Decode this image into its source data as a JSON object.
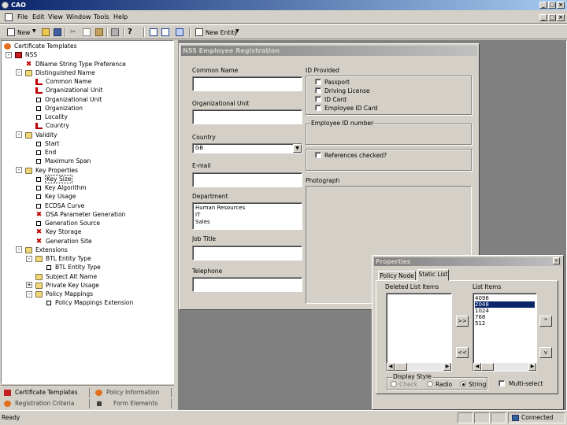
{
  "app": {
    "title": "CAO"
  },
  "menu": [
    "File",
    "Edit",
    "View",
    "Window",
    "Tools",
    "Help"
  ],
  "toolbar": {
    "new_label": "New",
    "new_entity_label": "New Entity"
  },
  "tree": {
    "root": "Certificate Templates",
    "items": [
      {
        "label": "NSS",
        "icon": "nss-icon",
        "depth": 1,
        "expander": "-"
      },
      {
        "label": "DName String Type Preference",
        "icon": "red-x-icon",
        "depth": 2
      },
      {
        "label": "Distinguished Name",
        "icon": "folder-icon",
        "depth": 2,
        "expander": "-"
      },
      {
        "label": "Common Name",
        "icon": "red-check-icon",
        "depth": 3
      },
      {
        "label": "Organizational Unit",
        "icon": "red-check-icon",
        "depth": 3
      },
      {
        "label": "Organizational Unit",
        "icon": "box-icon",
        "depth": 3
      },
      {
        "label": "Organization",
        "icon": "box-icon",
        "depth": 3
      },
      {
        "label": "Locality",
        "icon": "box-icon",
        "depth": 3
      },
      {
        "label": "Country",
        "icon": "red-check-icon",
        "depth": 3
      },
      {
        "label": "Validity",
        "icon": "folder-icon",
        "depth": 2,
        "expander": "-"
      },
      {
        "label": "Start",
        "icon": "box-icon",
        "depth": 3
      },
      {
        "label": "End",
        "icon": "box-icon",
        "depth": 3
      },
      {
        "label": "Maximum Span",
        "icon": "box-icon",
        "depth": 3
      },
      {
        "label": "Key Properties",
        "icon": "folder-icon",
        "depth": 2,
        "expander": "-"
      },
      {
        "label": "Key Size",
        "icon": "box-icon",
        "depth": 3,
        "selected": true
      },
      {
        "label": "Key Algorithm",
        "icon": "box-icon",
        "depth": 3
      },
      {
        "label": "Key Usage",
        "icon": "box-icon",
        "depth": 3
      },
      {
        "label": "ECDSA Curve",
        "icon": "box-icon",
        "depth": 3
      },
      {
        "label": "DSA Parameter Generation",
        "icon": "red-x-icon",
        "depth": 3
      },
      {
        "label": "Generation Source",
        "icon": "box-icon",
        "depth": 3
      },
      {
        "label": "Key Storage",
        "icon": "red-x-icon",
        "depth": 3
      },
      {
        "label": "Generation Site",
        "icon": "red-x-icon",
        "depth": 3
      },
      {
        "label": "Extensions",
        "icon": "folder-icon",
        "depth": 2,
        "expander": "-"
      },
      {
        "label": "BTL Entity Type",
        "icon": "folder-icon",
        "depth": 3,
        "expander": "-"
      },
      {
        "label": "BTL Entity Type",
        "icon": "box-icon",
        "depth": 4
      },
      {
        "label": "Subject Alt Name",
        "icon": "folder-icon",
        "depth": 3
      },
      {
        "label": "Private Key Usage",
        "icon": "folder-icon",
        "depth": 3,
        "expander": "+"
      },
      {
        "label": "Policy Mappings",
        "icon": "folder-icon",
        "depth": 3,
        "expander": "-"
      },
      {
        "label": "Policy Mappings Extension",
        "icon": "box-icon",
        "depth": 4
      }
    ]
  },
  "bottom_tabs": {
    "certificate_templates": "Certificate Templates",
    "policy_information": "Policy Information",
    "registration_criteria": "Registration Criteria",
    "form_elements": "Form Elements"
  },
  "form": {
    "title": "NSS Employee Registration",
    "common_name_label": "Common Name",
    "org_unit_label": "Organizational Unit",
    "country_label": "Country",
    "country_value": "GB",
    "email_label": "E-mail",
    "department_label": "Department",
    "departments": [
      "Human Resources",
      "IT",
      "Sales"
    ],
    "job_title_label": "Job Title",
    "telephone_label": "Telephone",
    "id_provided_label": "ID Provided",
    "id_options": [
      "Passport",
      "Driving License",
      "ID Card",
      "Employee ID Card"
    ],
    "employee_id_label": "Employee ID number",
    "references_label": "References checked?",
    "photograph_label": "Photograph"
  },
  "properties": {
    "title": "Properties",
    "tab_policy_node": "Policy Node",
    "tab_static_list": "Static List",
    "deleted_label": "Deleted List Items",
    "list_label": "List Items",
    "list_items": [
      "4096",
      "2048",
      "1024",
      "768",
      "512"
    ],
    "selected_item": "2048",
    "move_right": ">>",
    "move_left": "<<",
    "up": "^",
    "down": "v",
    "display_style_label": "Display Style",
    "style_check": "Check",
    "style_radio": "Radio",
    "style_string": "String",
    "multi_select_label": "Multi-select"
  },
  "status": {
    "ready": "Ready",
    "connection": "Connected"
  }
}
